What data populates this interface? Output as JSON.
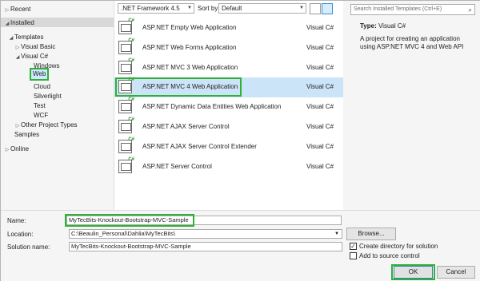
{
  "left_pane": {
    "recent": "Recent",
    "installed": "Installed",
    "templates": "Templates",
    "visual_basic": "Visual Basic",
    "visual_csharp": "Visual C#",
    "children": [
      "Windows",
      "Web",
      "Cloud",
      "Silverlight",
      "Test",
      "WCF"
    ],
    "other_project_types": "Other Project Types",
    "samples": "Samples",
    "online": "Online"
  },
  "toolbar": {
    "framework": ".NET Framework 4.5",
    "sort_label": "Sort by:",
    "sort_value": "Default"
  },
  "templates": [
    {
      "name": "ASP.NET Empty Web Application",
      "lang": "Visual C#"
    },
    {
      "name": "ASP.NET Web Forms Application",
      "lang": "Visual C#"
    },
    {
      "name": "ASP.NET MVC 3 Web Application",
      "lang": "Visual C#"
    },
    {
      "name": "ASP.NET MVC 4 Web Application",
      "lang": "Visual C#"
    },
    {
      "name": "ASP.NET Dynamic Data Entities Web Application",
      "lang": "Visual C#"
    },
    {
      "name": "ASP.NET AJAX Server Control",
      "lang": "Visual C#"
    },
    {
      "name": "ASP.NET AJAX Server Control Extender",
      "lang": "Visual C#"
    },
    {
      "name": "ASP.NET Server Control",
      "lang": "Visual C#"
    }
  ],
  "right_pane": {
    "search_placeholder": "Search Installed Templates (Ctrl+E)",
    "type_label": "Type:",
    "type_value": "Visual C#",
    "description": "A project for creating an application using ASP.NET MVC 4 and Web API"
  },
  "bottom": {
    "name_label": "Name:",
    "name_value": "MyTecBits-Knockout-Bootstrap-MVC-Sample",
    "location_label": "Location:",
    "location_value": "C:\\Beaulin_Personal\\Dahlia\\MyTecBits\\",
    "solution_label": "Solution name:",
    "solution_value": "MyTecBits-Knockout-Bootstrap-MVC-Sample",
    "browse": "Browse...",
    "create_dir": "Create directory for solution",
    "add_source": "Add to source control",
    "ok": "OK",
    "cancel": "Cancel"
  },
  "colors": {
    "highlight_green": "#2eb135",
    "selection": "#cce4f7"
  }
}
